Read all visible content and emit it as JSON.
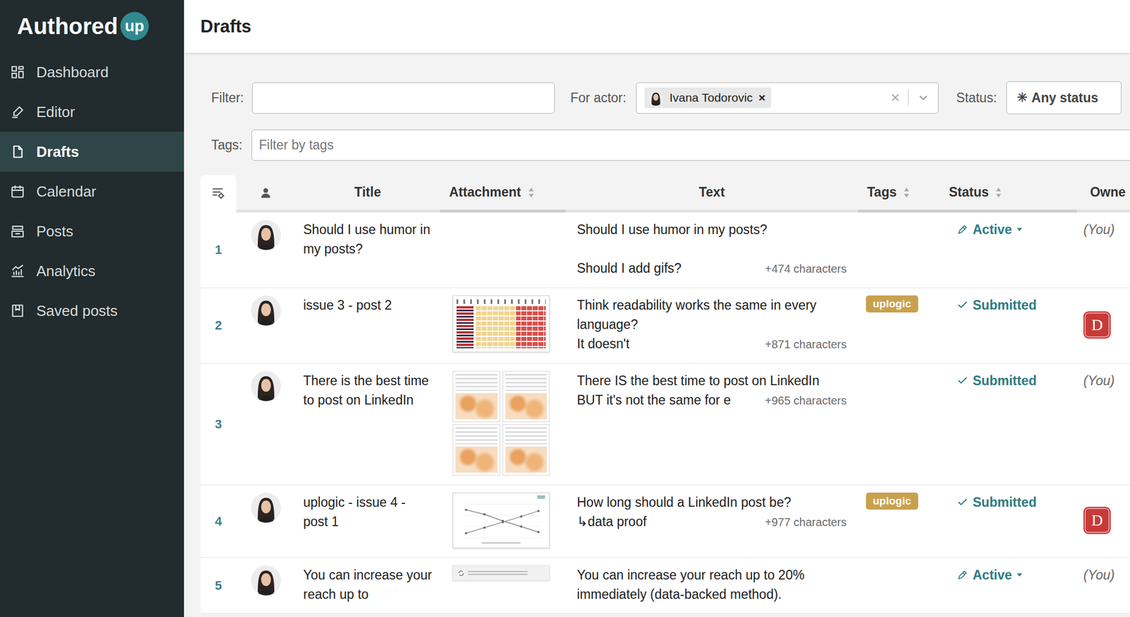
{
  "app": {
    "logo": {
      "word": "Authored",
      "badge": "up"
    }
  },
  "sidebar": {
    "items": [
      {
        "label": "Dashboard",
        "selected": false
      },
      {
        "label": "Editor",
        "selected": false
      },
      {
        "label": "Drafts",
        "selected": true
      },
      {
        "label": "Calendar",
        "selected": false
      },
      {
        "label": "Posts",
        "selected": false
      },
      {
        "label": "Analytics",
        "selected": false
      },
      {
        "label": "Saved posts",
        "selected": false
      }
    ]
  },
  "page": {
    "title": "Drafts"
  },
  "filters": {
    "filter_label": "Filter:",
    "filter_value": "",
    "actor_label": "For actor:",
    "actor_chip": {
      "name": "Ivana Todorovic",
      "remove": "×"
    },
    "actor_clear": "×",
    "status_label": "Status:",
    "status_button": {
      "icon": "✳",
      "label": "Any status"
    },
    "tags_label": "Tags:",
    "tags_placeholder": "Filter by tags"
  },
  "table": {
    "columns": [
      {
        "label": "Title",
        "sortable": false
      },
      {
        "label": "Attachment",
        "sortable": true
      },
      {
        "label": "Text",
        "sortable": false
      },
      {
        "label": "Tags",
        "sortable": true
      },
      {
        "label": "Status",
        "sortable": true
      },
      {
        "label": "Owne",
        "sortable": false
      }
    ],
    "rows": [
      {
        "number": "1",
        "title": "Should I use humor in my posts?",
        "attachment": {
          "kind": "none"
        },
        "lines": [
          "Should I use humor in my posts?",
          "",
          "Should I add gifs?"
        ],
        "more": "+474 characters",
        "tags": [],
        "status": {
          "label": "Active",
          "kind": "active"
        },
        "owner": {
          "kind": "you",
          "label": "(You)"
        }
      },
      {
        "number": "2",
        "title": "issue 3 - post 2",
        "attachment": {
          "kind": "table"
        },
        "lines": [
          "Think readability works the same in every language?",
          "It doesn't"
        ],
        "more": "+871 characters",
        "tags": [
          {
            "label": "uplogic",
            "color": "#c9a14e"
          }
        ],
        "status": {
          "label": "Submitted",
          "kind": "submitted"
        },
        "owner": {
          "kind": "avatar",
          "label": "D"
        }
      },
      {
        "number": "3",
        "title": "There is the best time to post on LinkedIn",
        "attachment": {
          "kind": "grid"
        },
        "lines": [
          "There IS the best time to post on LinkedIn",
          "BUT it's not the same for e"
        ],
        "more": "+965 characters",
        "tags": [],
        "status": {
          "label": "Submitted",
          "kind": "submitted"
        },
        "owner": {
          "kind": "you",
          "label": "(You)"
        }
      },
      {
        "number": "4",
        "title": "uplogic - issue 4 - post 1",
        "attachment": {
          "kind": "line"
        },
        "lines": [
          "How long should a LinkedIn post be?",
          "↳data proof"
        ],
        "more": "+977 characters",
        "tags": [
          {
            "label": "uplogic",
            "color": "#c9a14e"
          }
        ],
        "status": {
          "label": "Submitted",
          "kind": "submitted"
        },
        "owner": {
          "kind": "avatar",
          "label": "D"
        }
      },
      {
        "number": "5",
        "title": "You can increase your reach up to",
        "attachment": {
          "kind": "repost"
        },
        "lines": [
          "You can increase your reach up to 20%",
          "immediately (data-backed method)."
        ],
        "more": "",
        "tags": [],
        "status": {
          "label": "Active",
          "kind": "active"
        },
        "owner": {
          "kind": "you",
          "label": "(You)"
        }
      }
    ]
  }
}
